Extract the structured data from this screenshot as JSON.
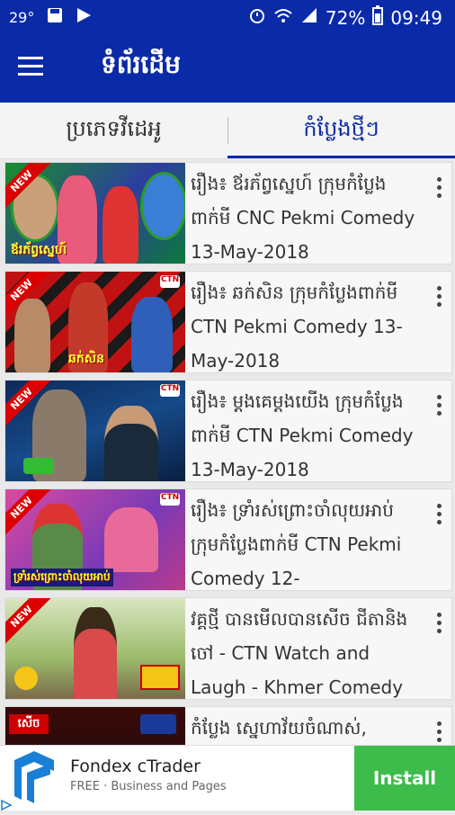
{
  "status_bar": {
    "temperature": "29°",
    "battery": "72%",
    "time": "09:49"
  },
  "app_bar": {
    "title": "ទំព័រដើម"
  },
  "tabs": [
    {
      "label": "ប្រភេទវីដេអូ",
      "active": false
    },
    {
      "label": "កំប្លែងថ្មីៗ",
      "active": true
    }
  ],
  "videos": [
    {
      "title": "រឿង៖ ឪរភ័ព្វស្នេហ៍ ក្រុមកំប្លែងពាក់មី CNC Pekmi Comedy 13-May-2018",
      "thumb_caption": "ឪរភ័ព្វស្នេហ៍",
      "thumb_badge": "NEW"
    },
    {
      "title": "រឿង៖ ឆក់សិន ក្រុមកំប្លែងពាក់មី CTN Pekmi Comedy 13-May-2018",
      "thumb_caption": "ឆក់សិន",
      "thumb_badge": "NEW"
    },
    {
      "title": "រឿង៖ ម្តងគេម្តងយើង ក្រុមកំប្លែងពាក់មី CTN Pekmi Comedy 13-May-2018",
      "thumb_caption": "",
      "thumb_badge": "NEW"
    },
    {
      "title": "រឿង៖ ទ្រាំរស់ព្រោះចាំលុយអាប់ ក្រុមកំប្លែងពាក់មី CTN Pekmi Comedy 12-",
      "thumb_caption": "ទ្រាំរស់ព្រោះចាំលុយអាប់",
      "thumb_badge": "NEW"
    },
    {
      "title": "វគ្គថ្មី បានមើលបានសើច ជីតានិង ចៅ - CTN Watch and Laugh - Khmer Comedy",
      "thumb_caption": "",
      "thumb_badge": "NEW"
    },
    {
      "title": "កំប្លែង ស្នេហាវ័យចំណាស់,",
      "thumb_caption": "សើច",
      "thumb_badge": ""
    }
  ],
  "ad": {
    "title": "Fondex cTrader",
    "subtitle": "FREE · Business and Pages",
    "button": "Install"
  },
  "colors": {
    "primary": "#0a2aa8",
    "install": "#3dbb4b"
  }
}
